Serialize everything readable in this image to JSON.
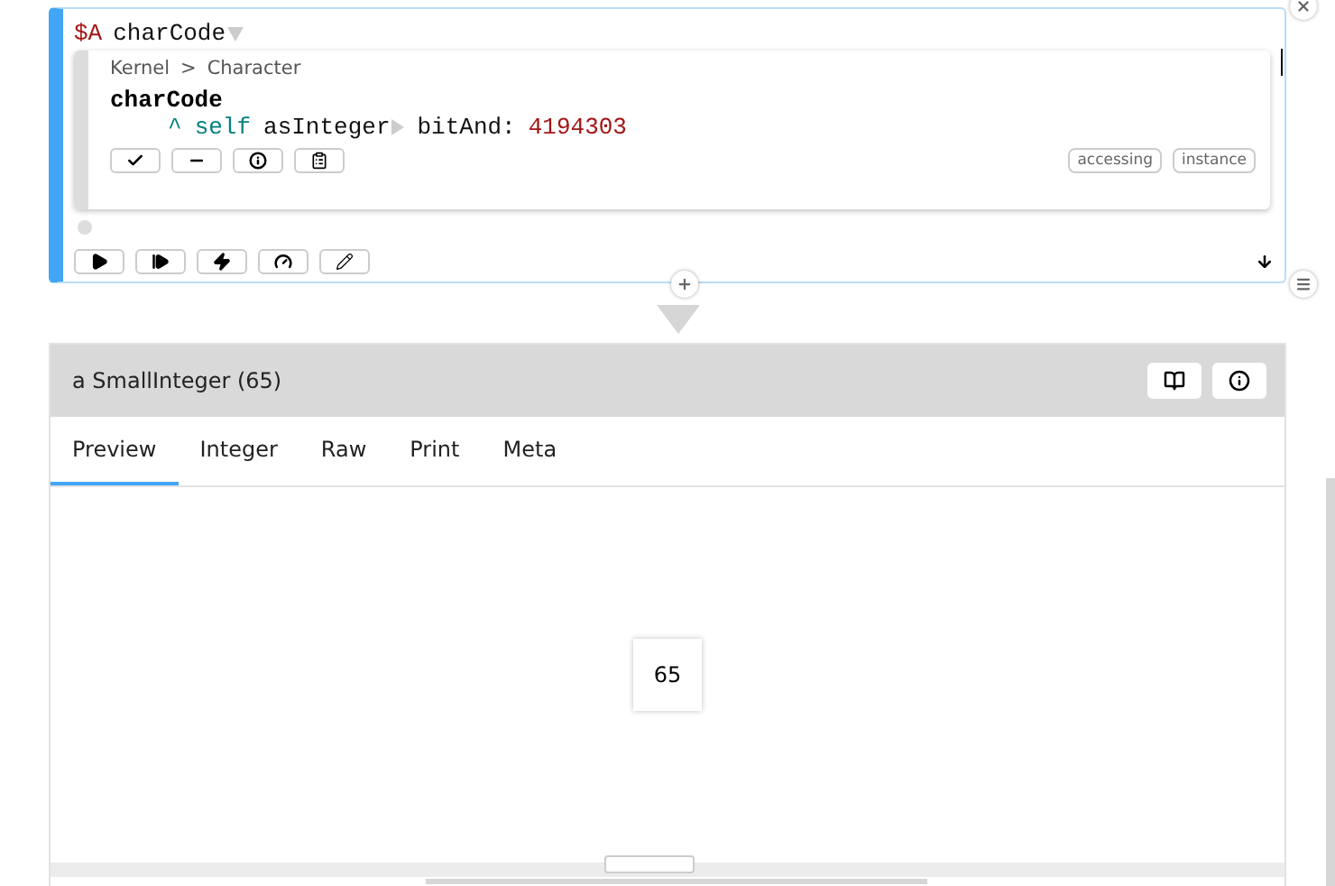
{
  "editor": {
    "variable": "$A",
    "selector": "charCode",
    "embedded": {
      "breadcrumb": [
        "Kernel",
        "Character"
      ],
      "separator": ">",
      "method": "charCode",
      "code": [
        {
          "text": "^",
          "kind": "keyword"
        },
        {
          "text": "self",
          "kind": "keyword"
        },
        {
          "text": "asInteger",
          "kind": "plain",
          "expander": true
        },
        {
          "text": "bitAnd:",
          "kind": "plain"
        },
        {
          "text": "4194303",
          "kind": "number"
        }
      ],
      "tags": [
        "accessing",
        "instance"
      ]
    }
  },
  "inspector": {
    "title": "a SmallInteger (65)",
    "tabs": [
      {
        "label": "Preview",
        "selected": true
      },
      {
        "label": "Integer",
        "selected": false
      },
      {
        "label": "Raw",
        "selected": false
      },
      {
        "label": "Print",
        "selected": false
      },
      {
        "label": "Meta",
        "selected": false
      }
    ],
    "preview": "65"
  }
}
